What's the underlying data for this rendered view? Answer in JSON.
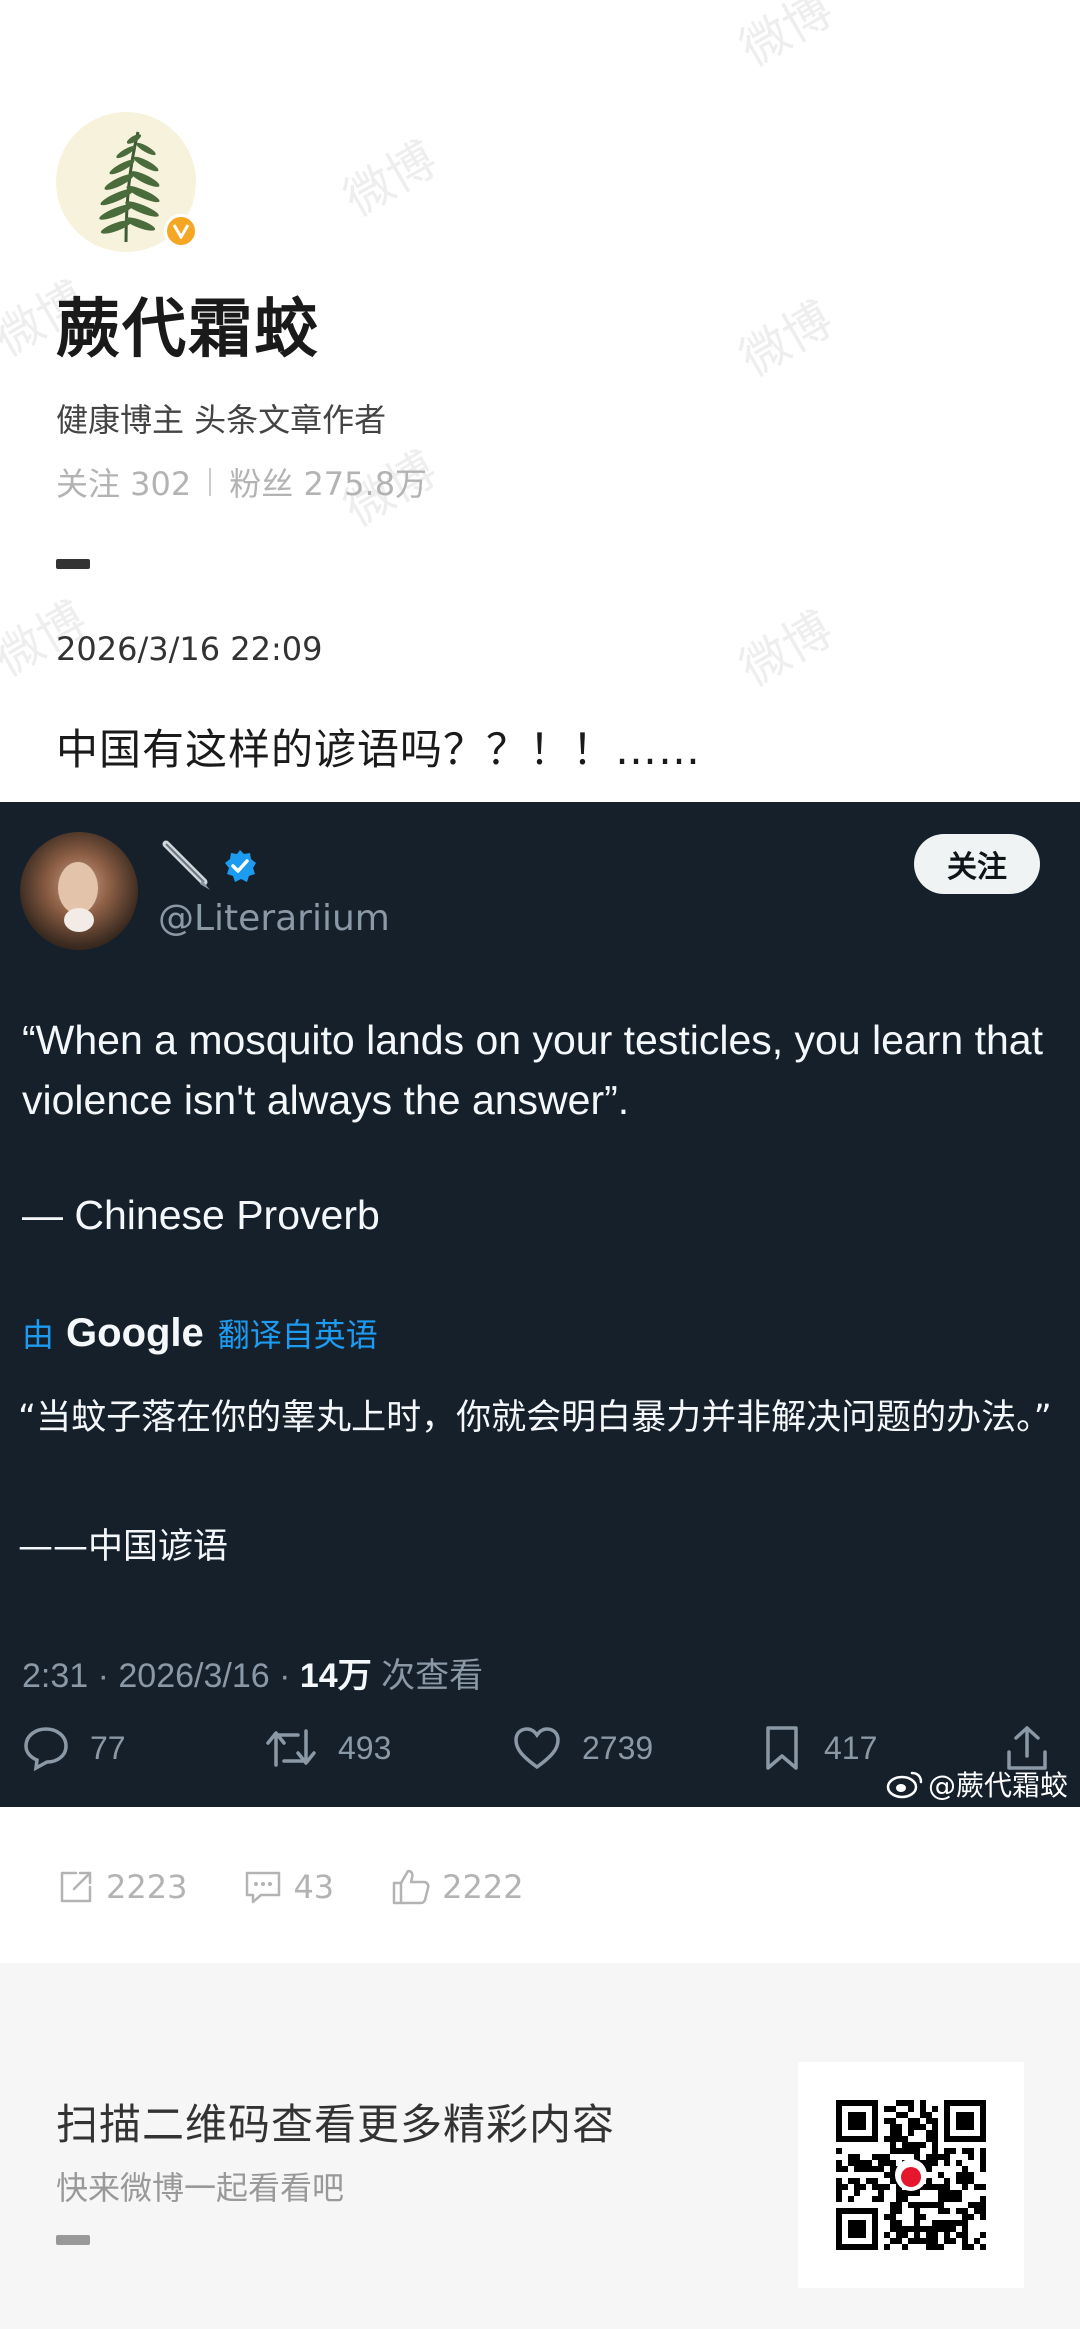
{
  "profile": {
    "name": "蕨代霜蛟",
    "description": "健康博主 头条文章作者",
    "following_label": "关注 302",
    "followers_label": "粉丝 275.8万"
  },
  "post": {
    "date": "2026/3/16 22:09",
    "text": "中国有这样的谚语吗？？！！……"
  },
  "tweet": {
    "handle": "@Literariium",
    "follow_label": "关注",
    "quote": "“When a mosquito lands on your testicles, you learn that violence isn't always the answer”.",
    "source": "— Chinese Proverb",
    "translated_by": "由",
    "translated_brand": "Google",
    "translated_from": "翻译自英语",
    "translation": "“当蚊子落在你的睾丸上时，你就会明白暴力并非解决问题的办法。”",
    "translation_source": "——中国谚语",
    "time": "2:31 · 2026/3/16 · ",
    "views": "14万",
    "views_suffix": " 次查看",
    "replies": "77",
    "retweets": "493",
    "likes": "2739",
    "bookmarks": "417",
    "weibo_watermark": "@蕨代霜蛟"
  },
  "post_stats": {
    "reposts": "2223",
    "comments": "43",
    "likes": "2222"
  },
  "footer": {
    "title": "扫描二维码查看更多精彩内容",
    "subtitle": "快来微博一起看看吧"
  },
  "watermark": "微博",
  "colors": {
    "tweet_bg": "#15202b",
    "accent_blue": "#1d9bf0",
    "verified_badge": "#f5a623"
  }
}
